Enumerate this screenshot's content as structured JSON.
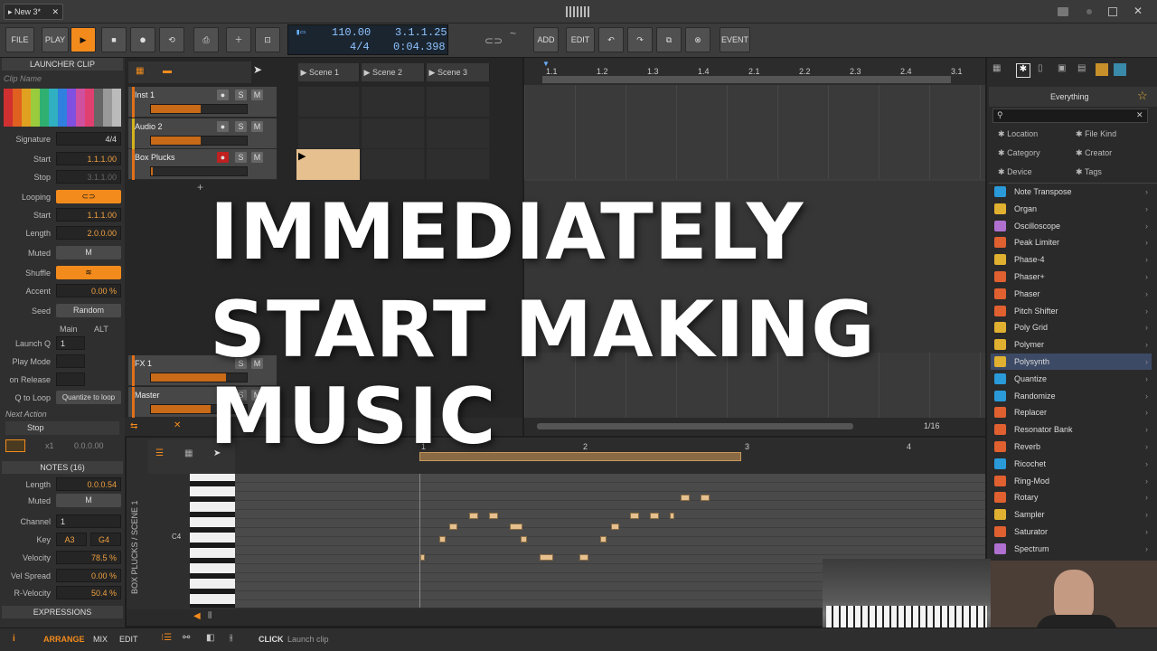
{
  "titlebar": {
    "tab_label": "New 3*",
    "tab_close": "✕"
  },
  "toolbar": {
    "file": "FILE",
    "play": "PLAY",
    "add": "ADD",
    "edit": "EDIT",
    "event": "EVENT",
    "tempo": "110.00",
    "signature": "4/4",
    "position": "3.1.1.25",
    "time": "0:04.398"
  },
  "inspector": {
    "header": "LAUNCHER CLIP",
    "clip_name_placeholder": "Clip Name",
    "signature_label": "Signature",
    "signature": "4/4",
    "start_label": "Start",
    "start": "1.1.1.00",
    "stop_label": "Stop",
    "stop": "3.1.1.00",
    "looping_label": "Looping",
    "loop_start_label": "Start",
    "loop_start": "1.1.1.00",
    "length_label": "Length",
    "length": "2.0.0.00",
    "muted_label": "Muted",
    "muted_btn": "M",
    "shuffle_label": "Shuffle",
    "accent_label": "Accent",
    "accent": "0.00 %",
    "seed_label": "Seed",
    "seed_btn": "Random",
    "main": "Main",
    "alt": "ALT",
    "launchq_label": "Launch Q",
    "launchq": "1",
    "playmode_label": "Play Mode",
    "onrelease_label": "on Release",
    "qtoloop_label": "Q to Loop",
    "qtoloop": "Quantize to loop",
    "next_action": "Next Action",
    "stop_action": "Stop",
    "next_count": "x1",
    "next_pos": "0.0.0.00",
    "notes_header": "NOTES (16)",
    "n_length_label": "Length",
    "n_length": "0.0.0.54",
    "n_muted_label": "Muted",
    "n_muted": "M",
    "channel_label": "Channel",
    "channel": "1",
    "key_label": "Key",
    "key_lo": "A3",
    "key_hi": "G4",
    "velocity_label": "Velocity",
    "velocity": "78.5 %",
    "velspread_label": "Vel Spread",
    "velspread": "0.00 %",
    "rvel_label": "R-Velocity",
    "rvel": "50.4 %",
    "expressions": "EXPRESSIONS"
  },
  "tracks": [
    {
      "name": "Inst 1",
      "color": "#e0701a",
      "fill": 0.52
    },
    {
      "name": "Audio 2",
      "color": "#d4b21c",
      "fill": 0.52
    },
    {
      "name": "Box Plucks",
      "color": "#e0701a",
      "fill": 0.02
    },
    {
      "name": "FX 1",
      "color": "#e0701a",
      "fill": 0.78
    },
    {
      "name": "Master",
      "color": "#e0701a",
      "fill": 0.62
    }
  ],
  "ms": {
    "s": "S",
    "m": "M"
  },
  "scenes": [
    "Scene 1",
    "Scene 2",
    "Scene 3"
  ],
  "ruler": [
    "1.1",
    "1.2",
    "1.3",
    "1.4",
    "2.1",
    "2.2",
    "2.3",
    "2.4",
    "3.1"
  ],
  "piano_ruler": [
    "1",
    "2",
    "3",
    "4"
  ],
  "piano_vertical": "BOX PLUCKS / SCENE 1",
  "piano_c4": "C4",
  "zoom_label": "1/16",
  "browser": {
    "title": "Everything",
    "filters": [
      "Location",
      "File Kind",
      "Category",
      "Creator",
      "Device",
      "Tags"
    ],
    "items": [
      {
        "name": "Note Transpose",
        "color": "#2a9ad8"
      },
      {
        "name": "Organ",
        "color": "#e0b030"
      },
      {
        "name": "Oscilloscope",
        "color": "#b070d0"
      },
      {
        "name": "Peak Limiter",
        "color": "#e06030"
      },
      {
        "name": "Phase-4",
        "color": "#e0b030"
      },
      {
        "name": "Phaser+",
        "color": "#e06030"
      },
      {
        "name": "Phaser",
        "color": "#e06030"
      },
      {
        "name": "Pitch Shifter",
        "color": "#e06030"
      },
      {
        "name": "Poly Grid",
        "color": "#e0b030"
      },
      {
        "name": "Polymer",
        "color": "#e0b030"
      },
      {
        "name": "Polysynth",
        "color": "#e0b030"
      },
      {
        "name": "Quantize",
        "color": "#2a9ad8"
      },
      {
        "name": "Randomize",
        "color": "#2a9ad8"
      },
      {
        "name": "Replacer",
        "color": "#e06030"
      },
      {
        "name": "Resonator Bank",
        "color": "#e06030"
      },
      {
        "name": "Reverb",
        "color": "#e06030"
      },
      {
        "name": "Ricochet",
        "color": "#2a9ad8"
      },
      {
        "name": "Ring-Mod",
        "color": "#e06030"
      },
      {
        "name": "Rotary",
        "color": "#e06030"
      },
      {
        "name": "Sampler",
        "color": "#e0b030"
      },
      {
        "name": "Saturator",
        "color": "#e06030"
      },
      {
        "name": "Spectrum",
        "color": "#b070d0"
      }
    ]
  },
  "overlay": {
    "line1": "IMMEDIATELY",
    "line2": "START MAKING",
    "line3": "MUSIC"
  },
  "bottom": {
    "arrange": "ARRANGE",
    "mix": "MIX",
    "edit": "EDIT",
    "click": "CLICK",
    "hint": "Launch clip"
  }
}
